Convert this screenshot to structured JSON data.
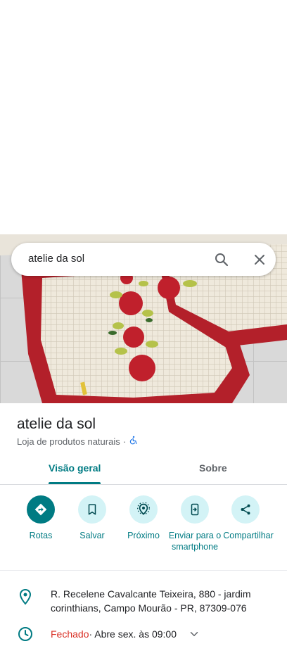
{
  "search": {
    "query": "atelie da sol",
    "search_icon": "search-icon",
    "clear_icon": "close-icon"
  },
  "place": {
    "name": "atelie da sol",
    "category": "Loja de produtos naturais",
    "separator": "·",
    "accessibility_icon": "wheelchair-icon"
  },
  "tabs": [
    {
      "label": "Visão geral",
      "active": true
    },
    {
      "label": "Sobre",
      "active": false
    }
  ],
  "actions": [
    {
      "label": "Rotas",
      "icon": "directions-icon"
    },
    {
      "label": "Salvar",
      "icon": "bookmark-icon"
    },
    {
      "label": "Próximo",
      "icon": "nearby-icon"
    },
    {
      "label": "Enviar para o smartphone",
      "icon": "send-to-phone-icon"
    },
    {
      "label": "Compartilhar",
      "icon": "share-icon"
    }
  ],
  "info": {
    "address": "R. Recelene Cavalcante Teixeira, 880 - jardim corinthians, Campo Mourão - PR, 87309-076",
    "hours_status": "Fechado",
    "hours_detail": " · Abre sex. às 09:00"
  },
  "colors": {
    "accent": "#007b83",
    "accent_light": "#d3f3f6",
    "closed": "#d93025",
    "rug_red": "#b3202a",
    "rug_cream": "#efe9dc"
  }
}
